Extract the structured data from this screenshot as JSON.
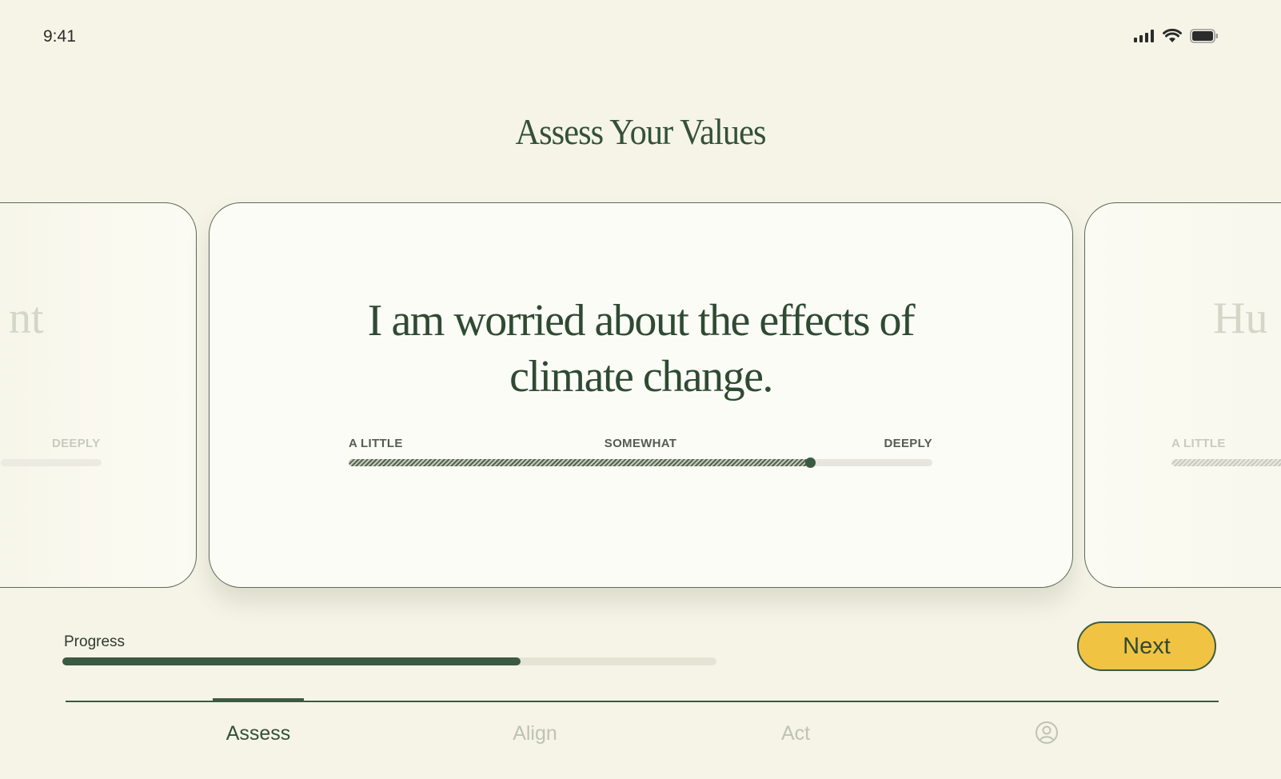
{
  "status_bar": {
    "time": "9:41",
    "icons": [
      "cellular-signal-icon",
      "wifi-icon",
      "battery-icon"
    ]
  },
  "page": {
    "title": "Assess Your Values"
  },
  "cards": {
    "previous": {
      "partial_text": "nt",
      "label": "DEEPLY"
    },
    "current": {
      "statement_line1": "I am worried about the effects of",
      "statement_line2": "climate change.",
      "scale": {
        "min_label": "A LITTLE",
        "mid_label": "SOMEWHAT",
        "max_label": "DEEPLY",
        "value": 0.79
      }
    },
    "next": {
      "partial_text": "Hu",
      "label": "A LITTLE"
    }
  },
  "progress": {
    "label": "Progress",
    "value": 0.7
  },
  "actions": {
    "next_label": "Next"
  },
  "nav": {
    "tabs": [
      {
        "label": "Assess",
        "active": true
      },
      {
        "label": "Align",
        "active": false
      },
      {
        "label": "Act",
        "active": false
      }
    ],
    "profile_icon": "user-circle-icon"
  },
  "colors": {
    "background": "#f5f4e6",
    "primary": "#3c5a41",
    "accent": "#f1c343"
  }
}
